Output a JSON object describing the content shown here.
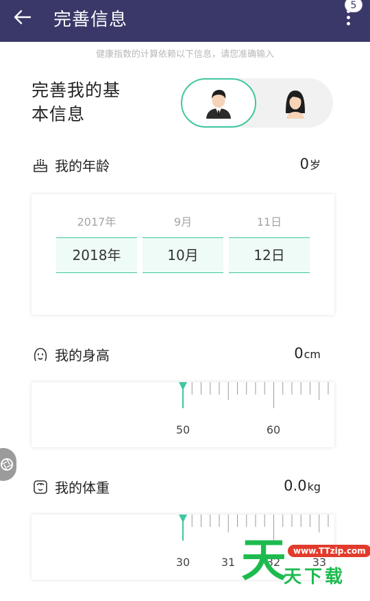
{
  "header": {
    "title": "完善信息",
    "badge": "5"
  },
  "hint": "健康指数的计算依赖以下信息，请您准确输入",
  "intro": {
    "title": "完善我的基本信息"
  },
  "gender": {
    "options": [
      {
        "name": "male",
        "selected": true
      },
      {
        "name": "female",
        "selected": false
      }
    ]
  },
  "age": {
    "label": "我的年龄",
    "value": "0",
    "unit": "岁",
    "picker": {
      "prev": [
        "2017年",
        "9月",
        "11日"
      ],
      "current": [
        "2018年",
        "10月",
        "12日"
      ]
    }
  },
  "height": {
    "label": "我的身高",
    "value": "0",
    "unit": "cm",
    "ruler_labels": [
      "50",
      "60"
    ],
    "selected_value": 50
  },
  "weight": {
    "label": "我的体重",
    "value": "0.0",
    "unit": "kg",
    "ruler_labels": [
      "30",
      "31",
      "32",
      "33"
    ],
    "selected_value": 30
  },
  "watermark": {
    "url": "www.TTzip.com",
    "big": "天",
    "text": "天下载"
  },
  "colors": {
    "header": "#3a3868",
    "accent": "#3ec6a0"
  }
}
